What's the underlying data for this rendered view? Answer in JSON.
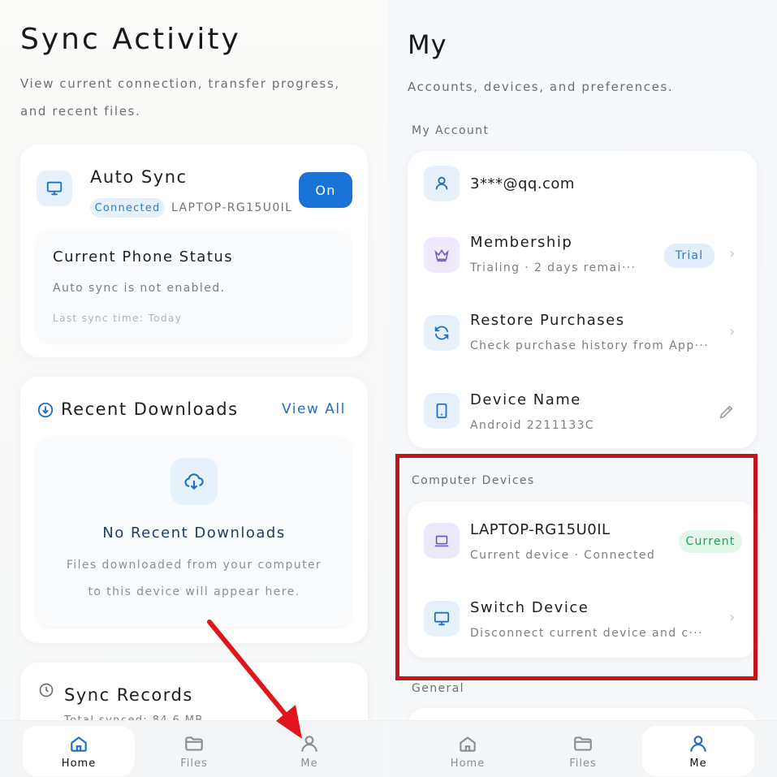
{
  "left": {
    "title": "Sync Activity",
    "subtitle_line1": "View current connection, transfer progress,",
    "subtitle_line2": "and recent files.",
    "auto_sync": {
      "title": "Auto Sync",
      "status_badge": "Connected",
      "device": "LAPTOP-RG15U0IL",
      "toggle_label": "On",
      "monitor_icon": "monitor-icon"
    },
    "phone_status": {
      "title": "Current Phone Status",
      "message": "Auto sync is not enabled.",
      "last_sync": "Last sync time: Today"
    },
    "recent_downloads": {
      "title": "Recent Downloads",
      "view_all": "View All",
      "empty_title": "No Recent Downloads",
      "empty_line1": "Files downloaded from your computer",
      "empty_line2": "to this device will appear here."
    },
    "sync_records": {
      "title": "Sync Records",
      "summary_partial": "Total synced: 84.6 MB"
    },
    "tabs": [
      {
        "label": "Home",
        "active": true
      },
      {
        "label": "Files",
        "active": false
      },
      {
        "label": "Me",
        "active": false
      }
    ]
  },
  "right": {
    "title": "My",
    "subtitle": "Accounts, devices, and preferences.",
    "my_account_label": "My Account",
    "account": {
      "email": "3***@qq.com"
    },
    "membership": {
      "title": "Membership",
      "desc": "Trialing · 2 days remai···",
      "badge": "Trial"
    },
    "restore": {
      "title": "Restore Purchases",
      "desc": "Check purchase history from App···"
    },
    "device_name": {
      "title": "Device Name",
      "value": "Android 2211133C"
    },
    "computer_devices_label": "Computer Devices",
    "laptop": {
      "title": "LAPTOP-RG15U0IL",
      "desc": "Current device · Connected",
      "badge": "Current"
    },
    "switch_device": {
      "title": "Switch Device",
      "desc": "Disconnect current device and c···"
    },
    "general_label": "General",
    "tabs": [
      {
        "label": "Home",
        "active": false
      },
      {
        "label": "Files",
        "active": false
      },
      {
        "label": "Me",
        "active": true
      }
    ]
  },
  "colors": {
    "accent_blue": "#1a73d6",
    "current_green": "#23a05a",
    "highlight_red": "#c0161c"
  }
}
